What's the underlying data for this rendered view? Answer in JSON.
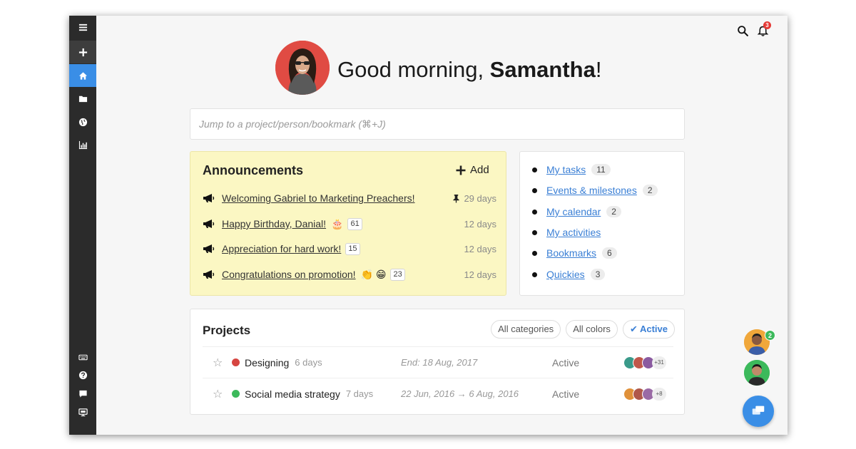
{
  "sidebar": {
    "items": [
      {
        "icon": "hamburger-icon"
      },
      {
        "icon": "plus-icon"
      },
      {
        "icon": "home-icon",
        "active": true
      },
      {
        "icon": "folder-icon"
      },
      {
        "icon": "globe-icon"
      },
      {
        "icon": "bar-chart-icon"
      }
    ],
    "bottom_items": [
      {
        "icon": "keyboard-icon"
      },
      {
        "icon": "help-icon"
      },
      {
        "icon": "chat-icon"
      },
      {
        "icon": "monitor-icon"
      }
    ],
    "accent": "#3a8ee6"
  },
  "header": {
    "search_icon": "search-icon",
    "notification_icon": "bell-icon",
    "notification_count": "3"
  },
  "greeting": {
    "prefix": "Good morning, ",
    "name": "Samantha",
    "suffix": "!"
  },
  "search": {
    "placeholder": "Jump to a project/person/bookmark (⌘+J)"
  },
  "announcements": {
    "title": "Announcements",
    "add_label": "Add",
    "items": [
      {
        "title": "Welcoming Gabriel to Marketing Preachers!",
        "emoji": "",
        "count": "",
        "pinned": true,
        "age": "29 days"
      },
      {
        "title": "Happy Birthday, Danial!",
        "emoji": "🎂",
        "count": "61",
        "pinned": false,
        "age": "12 days"
      },
      {
        "title": "Appreciation for hard work!",
        "emoji": "",
        "count": "15",
        "pinned": false,
        "age": "12 days"
      },
      {
        "title": "Congratulations on promotion!",
        "emoji": "👏 😁",
        "count": "23",
        "pinned": false,
        "age": "12 days"
      }
    ],
    "background": "#fbf7c3"
  },
  "quick_links": [
    {
      "label": "My tasks",
      "count": "11"
    },
    {
      "label": "Events & milestones",
      "count": "2"
    },
    {
      "label": "My calendar",
      "count": "2"
    },
    {
      "label": "My activities",
      "count": ""
    },
    {
      "label": "Bookmarks",
      "count": "6"
    },
    {
      "label": "Quickies",
      "count": "3"
    }
  ],
  "projects": {
    "title": "Projects",
    "filters": [
      "All categories",
      "All colors",
      "Active"
    ],
    "active_filter": "Active",
    "rows": [
      {
        "name": "Designing",
        "age": "6 days",
        "dates": "End: 18 Aug, 2017",
        "status": "Active",
        "color": "#d64541",
        "more": "+31"
      },
      {
        "name": "Social media strategy",
        "age": "7 days",
        "dates": "22 Jun, 2016 → 6 Aug, 2016",
        "status": "Active",
        "color": "#3cb95b",
        "more": "+8"
      }
    ]
  },
  "floating": {
    "online_count": "2",
    "chat_icon": "chat-bubbles-icon"
  }
}
